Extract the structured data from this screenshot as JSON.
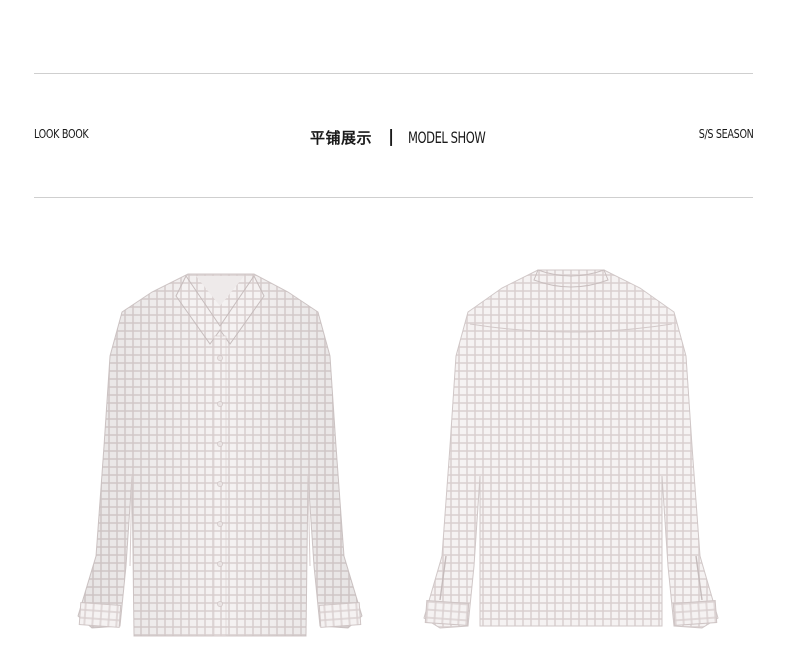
{
  "header": {
    "left_label": "LOOK BOOK",
    "title_cn": "平铺展示",
    "separator": "|",
    "title_en": "MODEL SHOW",
    "right_label": "S/S SEASON"
  },
  "colors": {
    "rule": "#cfcfcf",
    "shirt_base": "#f4f1f1",
    "gingham_line": "#c9bcbc"
  },
  "images": {
    "front": "shirt-front-image",
    "back": "shirt-back-image"
  }
}
